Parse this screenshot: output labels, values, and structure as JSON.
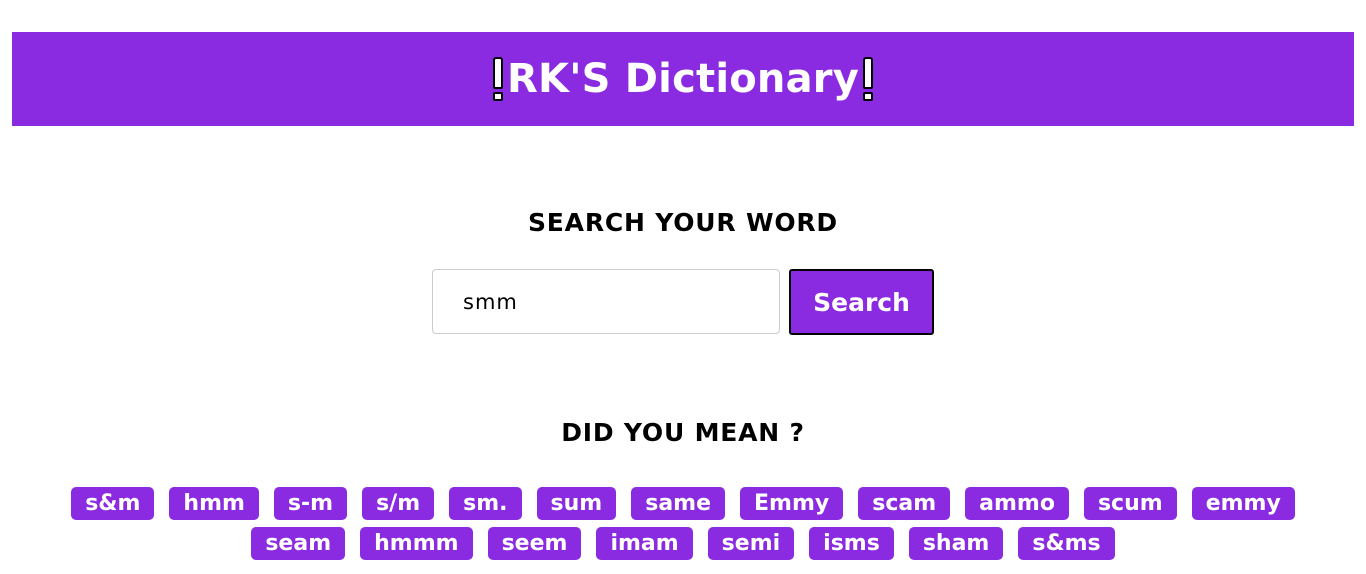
{
  "header": {
    "title": "RK'S Dictionary",
    "accent_color": "#8a2be2",
    "icon_left": "exclamation-icon",
    "icon_right": "exclamation-icon"
  },
  "search": {
    "heading": "SEARCH YOUR WORD",
    "value": "smm",
    "button_label": "Search"
  },
  "suggestions": {
    "heading": "DID YOU MEAN ?",
    "items": [
      "s&m",
      "hmm",
      "s-m",
      "s/m",
      "sm.",
      "sum",
      "same",
      "Emmy",
      "scam",
      "ammo",
      "scum",
      "emmy",
      "seam",
      "hmmm",
      "seem",
      "imam",
      "semi",
      "isms",
      "sham",
      "s&ms"
    ]
  }
}
